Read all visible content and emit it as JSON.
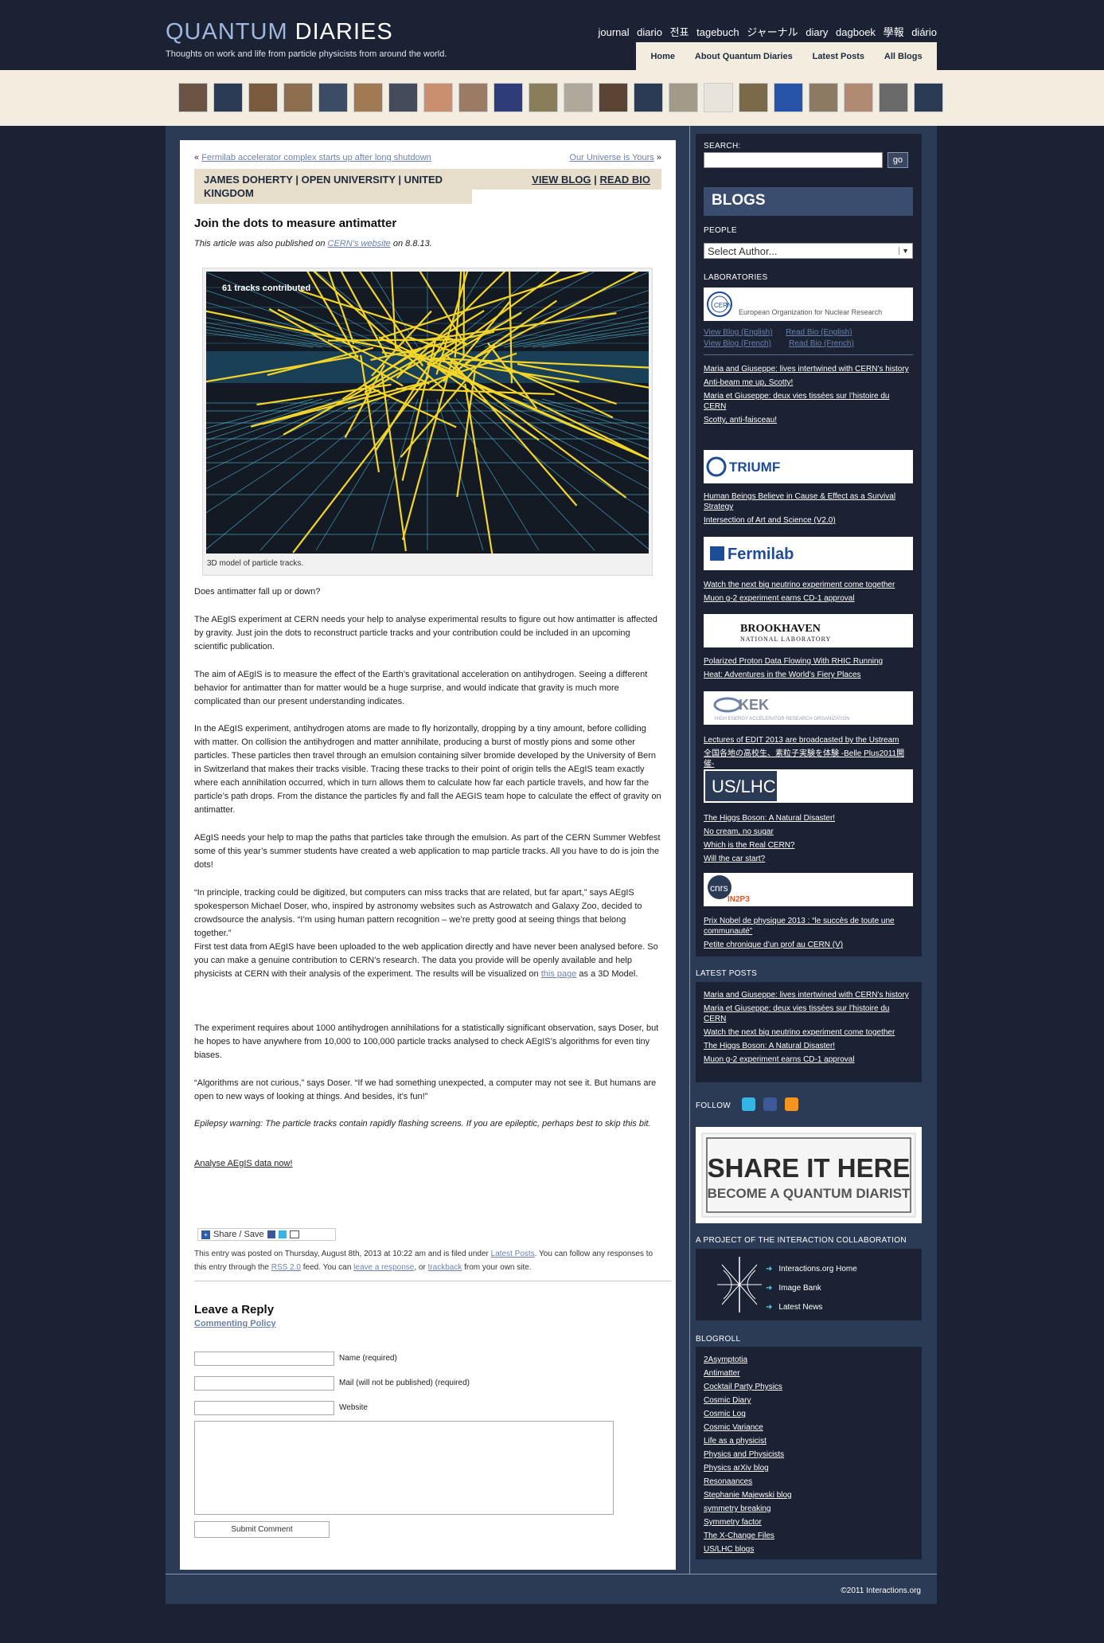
{
  "header": {
    "logo_quantum": "QUANTUM",
    "logo_diaries": "DIARIES",
    "tagline": "Thoughts on work and life from particle physicists from around the world.",
    "languages": [
      "journal",
      "diario",
      "전표",
      "tagebuch",
      "ジャーナル",
      "diary",
      "dagboek",
      "學報",
      "diário"
    ],
    "nav": [
      "Home",
      "About Quantum Diaries",
      "Latest Posts",
      "All Blogs"
    ]
  },
  "post": {
    "prev_marker": "«",
    "prev_link": "Fermilab accelerator complex starts up after long shutdown",
    "next_link": "Our Universe is Yours",
    "next_marker": "»",
    "author": "JAMES DOHERTY | OPEN UNIVERSITY | UNITED KINGDOM",
    "view_blog": "VIEW BLOG",
    "read_bio": "READ BIO",
    "author_sep": "|",
    "title": "Join the dots to measure antimatter",
    "also_pre": "This article was also published on ",
    "also_link": "CERN’s website",
    "also_post": " on 8.8.13.",
    "figure_overlay": "61 tracks contributed",
    "figure_caption": "3D model of particle tracks.",
    "p1": "Does antimatter fall up or down?",
    "p2": "The AEgIS experiment at CERN needs your help to analyse experimental results to figure out how antimatter is affected by gravity. Just join the dots to reconstruct particle tracks and your contribution could be included in an upcoming scientific publication.",
    "p3": "The aim of AEgIS is to measure the effect of the Earth’s gravitational acceleration on antihydrogen. Seeing a different behavior for antimatter than for matter would be a huge surprise, and would indicate that gravity is much more complicated than our present understanding indicates.",
    "p4": "In the AEgIS experiment, antihydrogen atoms are made to fly horizontally, dropping by a tiny amount, before colliding with matter. On collision the antihydrogen and matter annihilate, producing a burst of mostly pions and some other particles. These particles then travel through an emulsion containing silver bromide developed by the University of Bern in Switzerland that makes their tracks visible. Tracing these tracks to their point of origin tells the AEgIS team exactly where each annihilation occurred, which in turn allows them to calculate how far each particle travels, and how far the particle’s path drops. From the distance the particles fly and fall the AEGIS team hope to calculate the effect of gravity on antimatter.",
    "p5": "AEgIS needs your help to map the paths that particles take through the emulsion. As part of the CERN Summer Webfest some of this year’s summer students have created a web application to map particle tracks. All you have to do is join the dots!",
    "p6": "“In principle, tracking could be digitized, but computers can miss tracks that are related, but far apart,” says AEgIS spokesperson Michael Doser, who, inspired by astronomy websites such as Astrowatch and Galaxy Zoo, decided to crowdsource the analysis. “I’m using human pattern recognition – we’re pretty good at seeing things that belong together.”",
    "p7_pre": "First test data from AEgIS have been uploaded to the web application directly and have never been analysed before. So you can make a genuine contribution to CERN’s research. The data you provide will be openly available and help physicists at CERN with their analysis of the experiment. The results will be visualized on ",
    "p7_link": "this page",
    "p7_post": " as a 3D Model.",
    "p8": "The experiment requires about 1000 antihydrogen annihilations for a statistically significant observation, says Doser, but he hopes to have anywhere from 10,000 to 100,000 particle tracks analysed to check AEgIS’s algorithms for even tiny biases.",
    "p9": "“Algorithms are not curious,” says Doser. “If we had something unexpected, a computer may not see it. But humans are open to new ways of looking at things. And besides, it’s fun!”",
    "p10": "Epilepsy warning: The particle tracks contain rapidly flashing screens. If you are epileptic, perhaps best to skip this bit.",
    "cta": "Analyse AEgIS data now!",
    "share_label": "Share / Save",
    "meta_1": "This entry was posted on Thursday, August 8th, 2013 at 10:22 am and is filed under ",
    "meta_cat": "Latest Posts",
    "meta_2": ". You can follow any responses to this entry through the ",
    "meta_rss": "RSS 2.0",
    "meta_3": " feed. You can ",
    "meta_resp": "leave a response",
    "meta_4": ", or ",
    "meta_tb": "trackback",
    "meta_5": " from your own site."
  },
  "reply": {
    "title": "Leave a Reply",
    "policy": "Commenting Policy",
    "name_label": "Name (required)",
    "mail_label": "Mail (will not be published) (required)",
    "website_label": "Website",
    "submit": "Submit Comment"
  },
  "sidebar": {
    "search_label": "SEARCH:",
    "go": "go",
    "blogs_heading": "BLOGS",
    "people_label": "PEOPLE",
    "author_select": "Select Author...",
    "labs_label": "LABORATORIES",
    "cern_caption": "European Organization for Nuclear Research",
    "cern_view_en": "View Blog (English)",
    "cern_bio_en": "Read Bio (English)",
    "cern_view_fr": "View Blog (French)",
    "cern_bio_fr": "Read Bio (French)",
    "cern_posts": [
      "Maria and Giuseppe: lives intertwined with CERN’s history",
      "Anti-beam me up, Scotty!",
      "Maria et Giuseppe: deux vies tissées sur l’histoire du CERN",
      "Scotty, anti-faisceau!"
    ],
    "triumf_logo": "TRIUMF",
    "triumf_posts": [
      "Human Beings Believe in Cause & Effect as a Survival Strategy",
      "Intersection of Art and Science (V2.0)"
    ],
    "fermilab_logo": "Fermilab",
    "fermilab_posts": [
      "Watch the next big neutrino experiment come together",
      "Muon g-2 experiment earns CD-1 approval"
    ],
    "bnl_logo": "BROOKHAVEN",
    "bnl_sub": "NATIONAL LABORATORY",
    "bnl_posts": [
      "Polarized Proton Data Flowing With RHIC Running",
      "Heat: Adventures in the World’s Fiery Places"
    ],
    "kek_logo": "KEK",
    "kek_sub": "HIGH ENERGY ACCELERATOR RESEARCH ORGANIZATION",
    "kek_posts": [
      "Lectures of EDIT 2013 are broadcasted by the Ustream",
      "全国各地の高校生、素粒子実験を体験 -Belle Plus2011開催-"
    ],
    "uslhc_logo": "US/LHC",
    "uslhc_posts": [
      "The Higgs Boson: A Natural Disaster!",
      "No cream, no sugar",
      "Which is the Real CERN?",
      "Will the car start?"
    ],
    "in2p3_logo": "IN2P3",
    "in2p3_posts": [
      "Prix Nobel de physique 2013 : “le succès de toute une communauté”",
      "Petite chronique d’un prof au CERN (V)"
    ],
    "latest_label": "LATEST POSTS",
    "latest_posts": [
      "Maria and Giuseppe: lives intertwined with CERN’s history",
      "Maria et Giuseppe: deux vies tissées sur l’histoire du CERN",
      "Watch the next big neutrino experiment come together",
      "The Higgs Boson: A Natural Disaster!",
      "Muon g-2 experiment earns CD-1 approval"
    ],
    "follow_label": "FOLLOW",
    "share_line1": "SHARE IT HERE",
    "share_line2": "BECOME A QUANTUM DIARIST",
    "project_label": "A PROJECT OF THE INTERACTION COLLABORATION",
    "interactions_links": [
      "Interactions.org Home",
      "Image Bank",
      "Latest News"
    ],
    "blogroll_label": "BLOGROLL",
    "blogroll": [
      "2Asymptotia",
      "Antimatter",
      "Cocktail Party Physics",
      "Cosmic Diary",
      "Cosmic Log",
      "Cosmic Variance",
      "Life as a physicist",
      "Physics and Physicists",
      "Physics arXiv blog",
      "Resonaances",
      "Stephanie Majewski blog",
      "symmetry breaking",
      "Symmetry factor",
      "The X-Change Files",
      "US/LHC blogs"
    ]
  },
  "footer": {
    "copyright": "©2011 Interactions.org"
  },
  "colors": {
    "page_bg": "#1b2233",
    "panel": "#2b3a55",
    "cream": "#f3ede0",
    "link": "#6b82ad",
    "track_yellow": "#f4d52a",
    "grid_cyan": "#5ad0f0"
  }
}
